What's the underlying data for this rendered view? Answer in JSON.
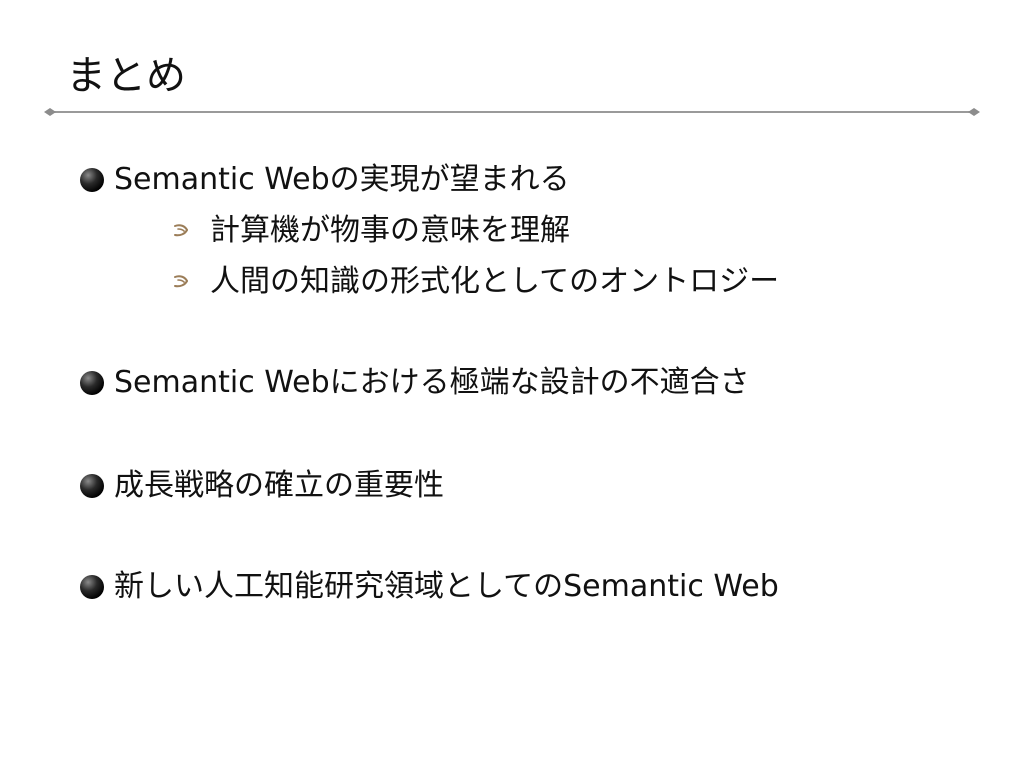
{
  "slide": {
    "title": "まとめ",
    "bullets": [
      {
        "text": "Semantic Webの実現が望まれる",
        "sub_items": [
          "計算機が物事の意味を理解",
          "人間の知識の形式化としてのオントロジー"
        ]
      },
      {
        "text": "Semantic Webにおける極端な設計の不適合さ"
      },
      {
        "text": "成長戦略の確立の重要性"
      },
      {
        "text": "新しい人工知能研究領域としてのSemantic Web"
      }
    ]
  },
  "icons": {
    "bullet": "black-sphere-bullet-icon",
    "sub_bullet": "curl-arrow-bullet-icon"
  },
  "colors": {
    "text": "#111111",
    "rule": "#9a9a9a",
    "sub_marker": "#9b7d58"
  }
}
